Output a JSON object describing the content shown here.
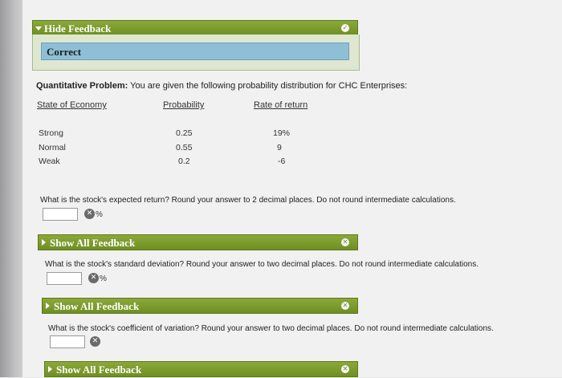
{
  "feedback": {
    "hide_label": "Hide Feedback",
    "status": "Correct",
    "hide_icon": "checkmark-icon"
  },
  "problem": {
    "prefix": "Quantitative Problem:",
    "text": " You are given the following probability distribution for CHC Enterprises:"
  },
  "table": {
    "headers": [
      "State of Economy",
      "Probability",
      "Rate of return"
    ],
    "rows": [
      {
        "state": "Strong",
        "probability": "0.25",
        "rate": "19%"
      },
      {
        "state": "Normal",
        "probability": "0.55",
        "rate": "9"
      },
      {
        "state": "Weak",
        "probability": "0.2",
        "rate": "-6"
      }
    ]
  },
  "questions": [
    {
      "text": "What is the stock's expected return? Round your answer to 2 decimal places. Do not round intermediate calculations.",
      "value": "",
      "unit": "%",
      "feedback_label": "Show All Feedback"
    },
    {
      "text": "What is the stock's standard deviation? Round your answer to two decimal places. Do not round intermediate calculations.",
      "value": "",
      "unit": "%",
      "feedback_label": "Show All Feedback"
    },
    {
      "text": "What is the stock's coefficient of variation? Round your answer to two decimal places. Do not round intermediate calculations.",
      "value": "",
      "unit": "",
      "feedback_label": "Show All Feedback"
    }
  ],
  "icons": {
    "incorrect": "x-circle-icon",
    "expand": "triangle-right-icon",
    "close": "close-circle-icon"
  },
  "colors": {
    "bar_green": "#6f8f22",
    "correct_blue": "#8fbfd7"
  }
}
